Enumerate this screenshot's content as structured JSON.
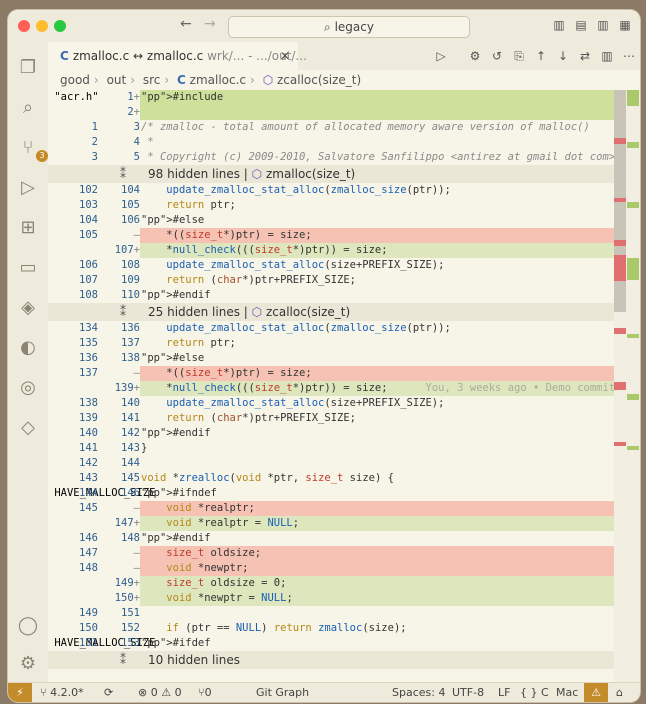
{
  "window": {
    "search_text": "legacy"
  },
  "activity": {
    "scm_badge": "3"
  },
  "tab": {
    "name": "zmalloc.c",
    "arrow": "↔",
    "name2": "zmalloc.c",
    "path": "wrk/... - .../out/...",
    "close": "✕"
  },
  "breadcrumb": [
    "good",
    "out",
    "src",
    "zmalloc.c",
    "zcalloc(size_t)"
  ],
  "code_rows": [
    {
      "l": "",
      "r": "1",
      "m": "+",
      "k": "hl",
      "t": "#include \"acr.h\""
    },
    {
      "l": "",
      "r": "2",
      "m": "+",
      "k": "hl",
      "t": ""
    },
    {
      "l": "1",
      "r": "3",
      "m": "",
      "k": "",
      "t": "/* zmalloc - total amount of allocated memory aware version of malloc()"
    },
    {
      "l": "2",
      "r": "4",
      "m": "",
      "k": "",
      "t": " *"
    },
    {
      "l": "3",
      "r": "5",
      "m": "",
      "k": "",
      "t": " * Copyright (c) 2009-2010, Salvatore Sanfilippo <antirez at gmail dot com>"
    },
    {
      "fold": "98 hidden lines",
      "sym": "zmalloc(size_t)"
    },
    {
      "l": "102",
      "r": "104",
      "m": "",
      "k": "",
      "t": "    update_zmalloc_stat_alloc(zmalloc_size(ptr));"
    },
    {
      "l": "103",
      "r": "105",
      "m": "",
      "k": "",
      "t": "    return ptr;"
    },
    {
      "l": "104",
      "r": "106",
      "m": "",
      "k": "",
      "t": "#else"
    },
    {
      "l": "105",
      "r": "",
      "m": "—",
      "k": "del",
      "t": "    *((size_t*)ptr) = size;"
    },
    {
      "l": "",
      "r": "107",
      "m": "+",
      "k": "ins",
      "t": "    *null_check(((size_t*)ptr)) = size;"
    },
    {
      "l": "106",
      "r": "108",
      "m": "",
      "k": "",
      "t": "    update_zmalloc_stat_alloc(size+PREFIX_SIZE);"
    },
    {
      "l": "107",
      "r": "109",
      "m": "",
      "k": "",
      "t": "    return (char*)ptr+PREFIX_SIZE;"
    },
    {
      "l": "108",
      "r": "110",
      "m": "",
      "k": "",
      "t": "#endif"
    },
    {
      "fold": "25 hidden lines",
      "sym": "zcalloc(size_t)"
    },
    {
      "l": "134",
      "r": "136",
      "m": "",
      "k": "",
      "t": "    update_zmalloc_stat_alloc(zmalloc_size(ptr));"
    },
    {
      "l": "135",
      "r": "137",
      "m": "",
      "k": "",
      "t": "    return ptr;"
    },
    {
      "l": "136",
      "r": "138",
      "m": "",
      "k": "",
      "t": "#else"
    },
    {
      "l": "137",
      "r": "",
      "m": "—",
      "k": "del",
      "t": "    *((size_t*)ptr) = size;"
    },
    {
      "l": "",
      "r": "139",
      "m": "+",
      "k": "ins",
      "t": "    *null_check(((size_t*)ptr)) = size;",
      "blame": "You, 3 weeks ago • Demo commit"
    },
    {
      "l": "138",
      "r": "140",
      "m": "",
      "k": "",
      "t": "    update_zmalloc_stat_alloc(size+PREFIX_SIZE);"
    },
    {
      "l": "139",
      "r": "141",
      "m": "",
      "k": "",
      "t": "    return (char*)ptr+PREFIX_SIZE;"
    },
    {
      "l": "140",
      "r": "142",
      "m": "",
      "k": "",
      "t": "#endif"
    },
    {
      "l": "141",
      "r": "143",
      "m": "",
      "k": "",
      "t": "}"
    },
    {
      "l": "142",
      "r": "144",
      "m": "",
      "k": "",
      "t": ""
    },
    {
      "l": "143",
      "r": "145",
      "m": "",
      "k": "",
      "t": "void *zrealloc(void *ptr, size_t size) {"
    },
    {
      "l": "144",
      "r": "146",
      "m": "",
      "k": "",
      "t": "#ifndef HAVE_MALLOC_SIZE"
    },
    {
      "l": "145",
      "r": "",
      "m": "—",
      "k": "del",
      "t": "    void *realptr;"
    },
    {
      "l": "",
      "r": "147",
      "m": "+",
      "k": "ins",
      "t": "    void *realptr = NULL;"
    },
    {
      "l": "146",
      "r": "148",
      "m": "",
      "k": "",
      "t": "#endif"
    },
    {
      "l": "147",
      "r": "",
      "m": "—",
      "k": "del",
      "t": "    size_t oldsize;"
    },
    {
      "l": "148",
      "r": "",
      "m": "—",
      "k": "del",
      "t": "    void *newptr;"
    },
    {
      "l": "",
      "r": "149",
      "m": "+",
      "k": "ins",
      "t": "    size_t oldsize = 0;"
    },
    {
      "l": "",
      "r": "150",
      "m": "+",
      "k": "ins",
      "t": "    void *newptr = NULL;"
    },
    {
      "l": "149",
      "r": "151",
      "m": "",
      "k": "",
      "t": ""
    },
    {
      "l": "150",
      "r": "152",
      "m": "",
      "k": "",
      "t": "    if (ptr == NULL) return zmalloc(size);"
    },
    {
      "l": "151",
      "r": "153",
      "m": "",
      "k": "",
      "t": "#ifdef HAVE_MALLOC_SIZE"
    },
    {
      "fold": "10 hidden lines",
      "sym": ""
    }
  ],
  "status": {
    "remote": "⚡",
    "branch": "4.2.0*",
    "errors": "⊗ 0 ⚠ 0",
    "ports": "⑂0",
    "gitgraph": "Git Graph",
    "spaces": "Spaces: 4",
    "encoding": "UTF-8",
    "eol": "LF",
    "lang": "{ } C",
    "platform": "Mac",
    "warn": "⚠",
    "bell": "🔔"
  },
  "colors": {
    "added": "#cfe09a",
    "removed": "#f5c2b4",
    "accent": "#c48b2a"
  }
}
